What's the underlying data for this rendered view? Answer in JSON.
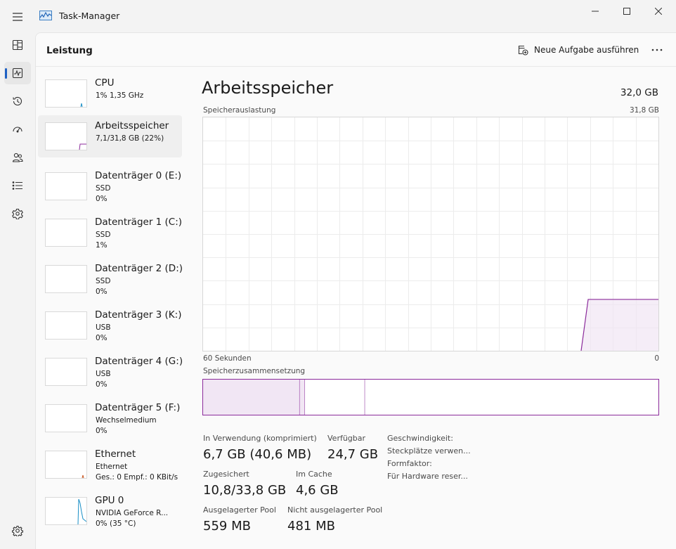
{
  "app": {
    "title": "Task-Manager"
  },
  "nav": {
    "items": [
      {
        "name": "processes",
        "icon": "processes-icon"
      },
      {
        "name": "performance",
        "icon": "performance-icon",
        "active": true
      },
      {
        "name": "app-history",
        "icon": "history-icon"
      },
      {
        "name": "startup-apps",
        "icon": "startup-icon"
      },
      {
        "name": "users",
        "icon": "users-icon"
      },
      {
        "name": "details",
        "icon": "details-icon"
      },
      {
        "name": "services",
        "icon": "services-icon"
      }
    ],
    "settings_icon": "gear-icon"
  },
  "header": {
    "title": "Leistung",
    "new_task_label": "Neue Aufgabe ausführen"
  },
  "resources": [
    {
      "name": "CPU",
      "lines": [
        "1% 1,35 GHz"
      ]
    },
    {
      "name": "Arbeitsspeicher",
      "lines": [
        "7,1/31,8 GB (22%)"
      ],
      "selected": true
    },
    {
      "name": "Datenträger 0 (E:)",
      "lines": [
        "SSD",
        "0%"
      ]
    },
    {
      "name": "Datenträger 1 (C:)",
      "lines": [
        "SSD",
        "1%"
      ]
    },
    {
      "name": "Datenträger 2 (D:)",
      "lines": [
        "SSD",
        "0%"
      ]
    },
    {
      "name": "Datenträger 3 (K:)",
      "lines": [
        "USB",
        "0%"
      ]
    },
    {
      "name": "Datenträger 4 (G:)",
      "lines": [
        "USB",
        "0%"
      ]
    },
    {
      "name": "Datenträger 5 (F:)",
      "lines": [
        "Wechselmedium",
        "0%"
      ]
    },
    {
      "name": "Ethernet",
      "lines": [
        "Ethernet",
        "Ges.: 0 Empf.: 0 KBit/s"
      ]
    },
    {
      "name": "GPU 0",
      "lines": [
        "NVIDIA GeForce R...",
        "0% (35 °C)"
      ]
    }
  ],
  "detail": {
    "title": "Arbeitsspeicher",
    "total": "32,0 GB",
    "usage_label": "Speicherauslastung",
    "usage_max": "31,8 GB",
    "time_left": "60 Sekunden",
    "time_right": "0",
    "composition_label": "Speicherzusammensetzung",
    "usage_percent": 22,
    "composition": {
      "in_use_fraction": 0.212,
      "modified_fraction": 0.011,
      "standby_fraction": 0.132
    },
    "stats": [
      {
        "label": "In Verwendung (komprimiert)",
        "value": "6,7 GB (40,6 MB)"
      },
      {
        "label": "Verfügbar",
        "value": "24,7 GB"
      },
      {
        "label": "Zugesichert",
        "value": "10,8/33,8 GB"
      },
      {
        "label": "Im Cache",
        "value": "4,6 GB"
      },
      {
        "label": "Ausgelagerter Pool",
        "value": "559 MB"
      },
      {
        "label": "Nicht ausgelagerter Pool",
        "value": "481 MB"
      }
    ],
    "props": [
      "Geschwindigkeit:",
      "Steckplätze verwen...",
      "Formfaktor:",
      "Für Hardware reser..."
    ]
  },
  "colors": {
    "memory": "#8b2a9b",
    "memory_fill": "#f1e6f4",
    "cpu": "#1a8fc6",
    "ethernet": "#c8541e",
    "accent": "#1f61c4"
  }
}
